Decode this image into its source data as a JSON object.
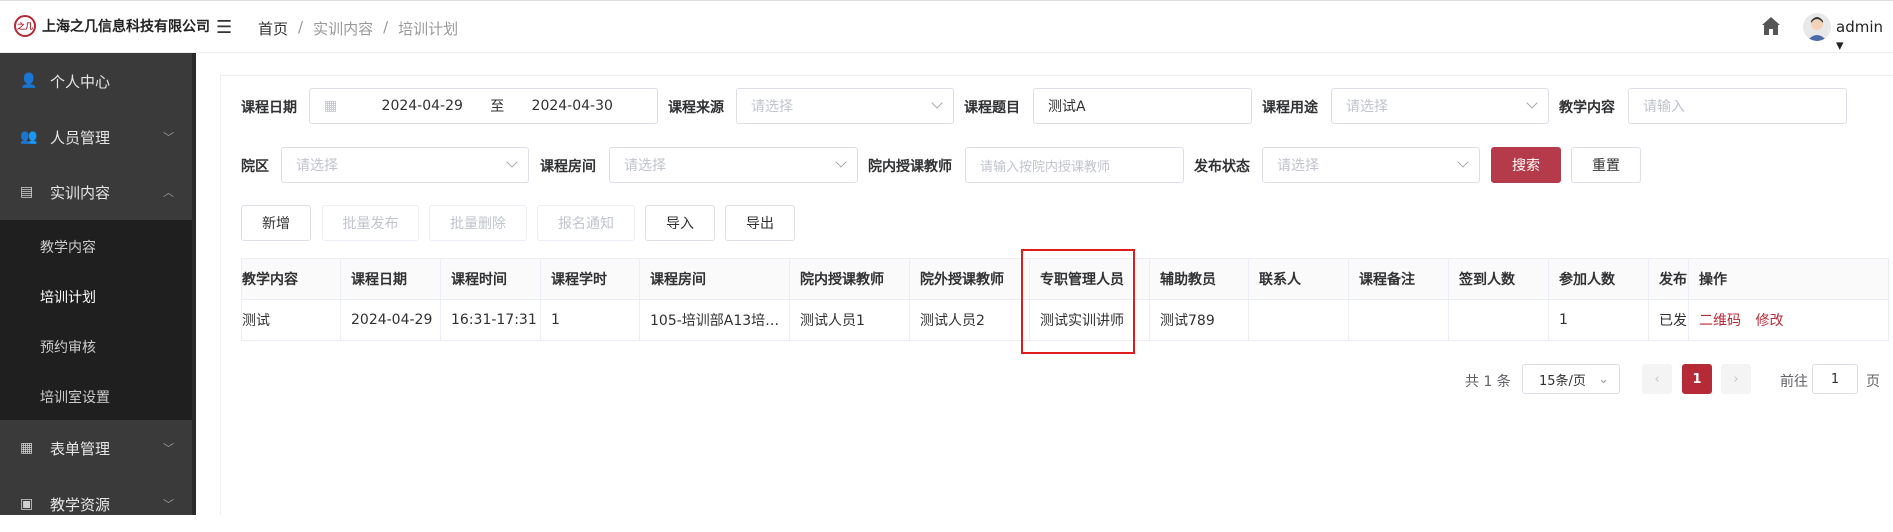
{
  "header": {
    "company": "上海之几信息科技有限公司",
    "logo_text": "之几",
    "breadcrumb": [
      "首页",
      "实训内容",
      "培训计划"
    ],
    "sep": "/",
    "user": "admin ▾"
  },
  "sidebar": {
    "items": [
      {
        "label": "个人中心",
        "icon": "user-icon"
      },
      {
        "label": "人员管理",
        "icon": "people-icon"
      },
      {
        "label": "实训内容",
        "icon": "content-icon"
      },
      {
        "label": "表单管理",
        "icon": "form-icon"
      },
      {
        "label": "教学资源",
        "icon": "resource-icon"
      }
    ],
    "subitems": [
      "教学内容",
      "培训计划",
      "预约审核",
      "培训室设置"
    ]
  },
  "filters": {
    "date_label": "课程日期",
    "date_start": "2024-04-29",
    "date_to": "至",
    "date_end": "2024-04-30",
    "source_label": "课程来源",
    "source_ph": "请选择",
    "topic_label": "课程题目",
    "topic_value": "测试A",
    "use_label": "课程用途",
    "use_ph": "请选择",
    "content_label": "教学内容",
    "content_ph": "请输入",
    "campus_label": "院区",
    "campus_ph": "请选择",
    "room_label": "课程房间",
    "room_ph": "请选择",
    "teacher_label": "院内授课教师",
    "teacher_ph": "请输入按院内授课教师",
    "status_label": "发布状态",
    "status_ph": "请选择",
    "search": "搜索",
    "reset": "重置"
  },
  "actions": [
    "新增",
    "批量发布",
    "批量删除",
    "报名通知",
    "导入",
    "导出"
  ],
  "table": {
    "headers": [
      "教学内容",
      "课程日期",
      "课程时间",
      "课程学时",
      "课程房间",
      "院内授课教师",
      "院外授课教师",
      "专职管理人员",
      "辅助教员",
      "联系人",
      "课程备注",
      "签到人数",
      "参加人数",
      "发布",
      "操作"
    ],
    "row": [
      "测试",
      "2024-04-29",
      "16:31-17:31",
      "1",
      "105-培训部A13培…",
      "测试人员1",
      "测试人员2",
      "测试实训讲师",
      "测试789",
      "",
      "",
      "",
      "1",
      "已发"
    ],
    "ops": [
      "二维码",
      "修改"
    ]
  },
  "pagination": {
    "total": "共 1 条",
    "size": "15条/页",
    "current": "1",
    "goto": "前往",
    "page_input": "1",
    "page_unit": "页"
  }
}
